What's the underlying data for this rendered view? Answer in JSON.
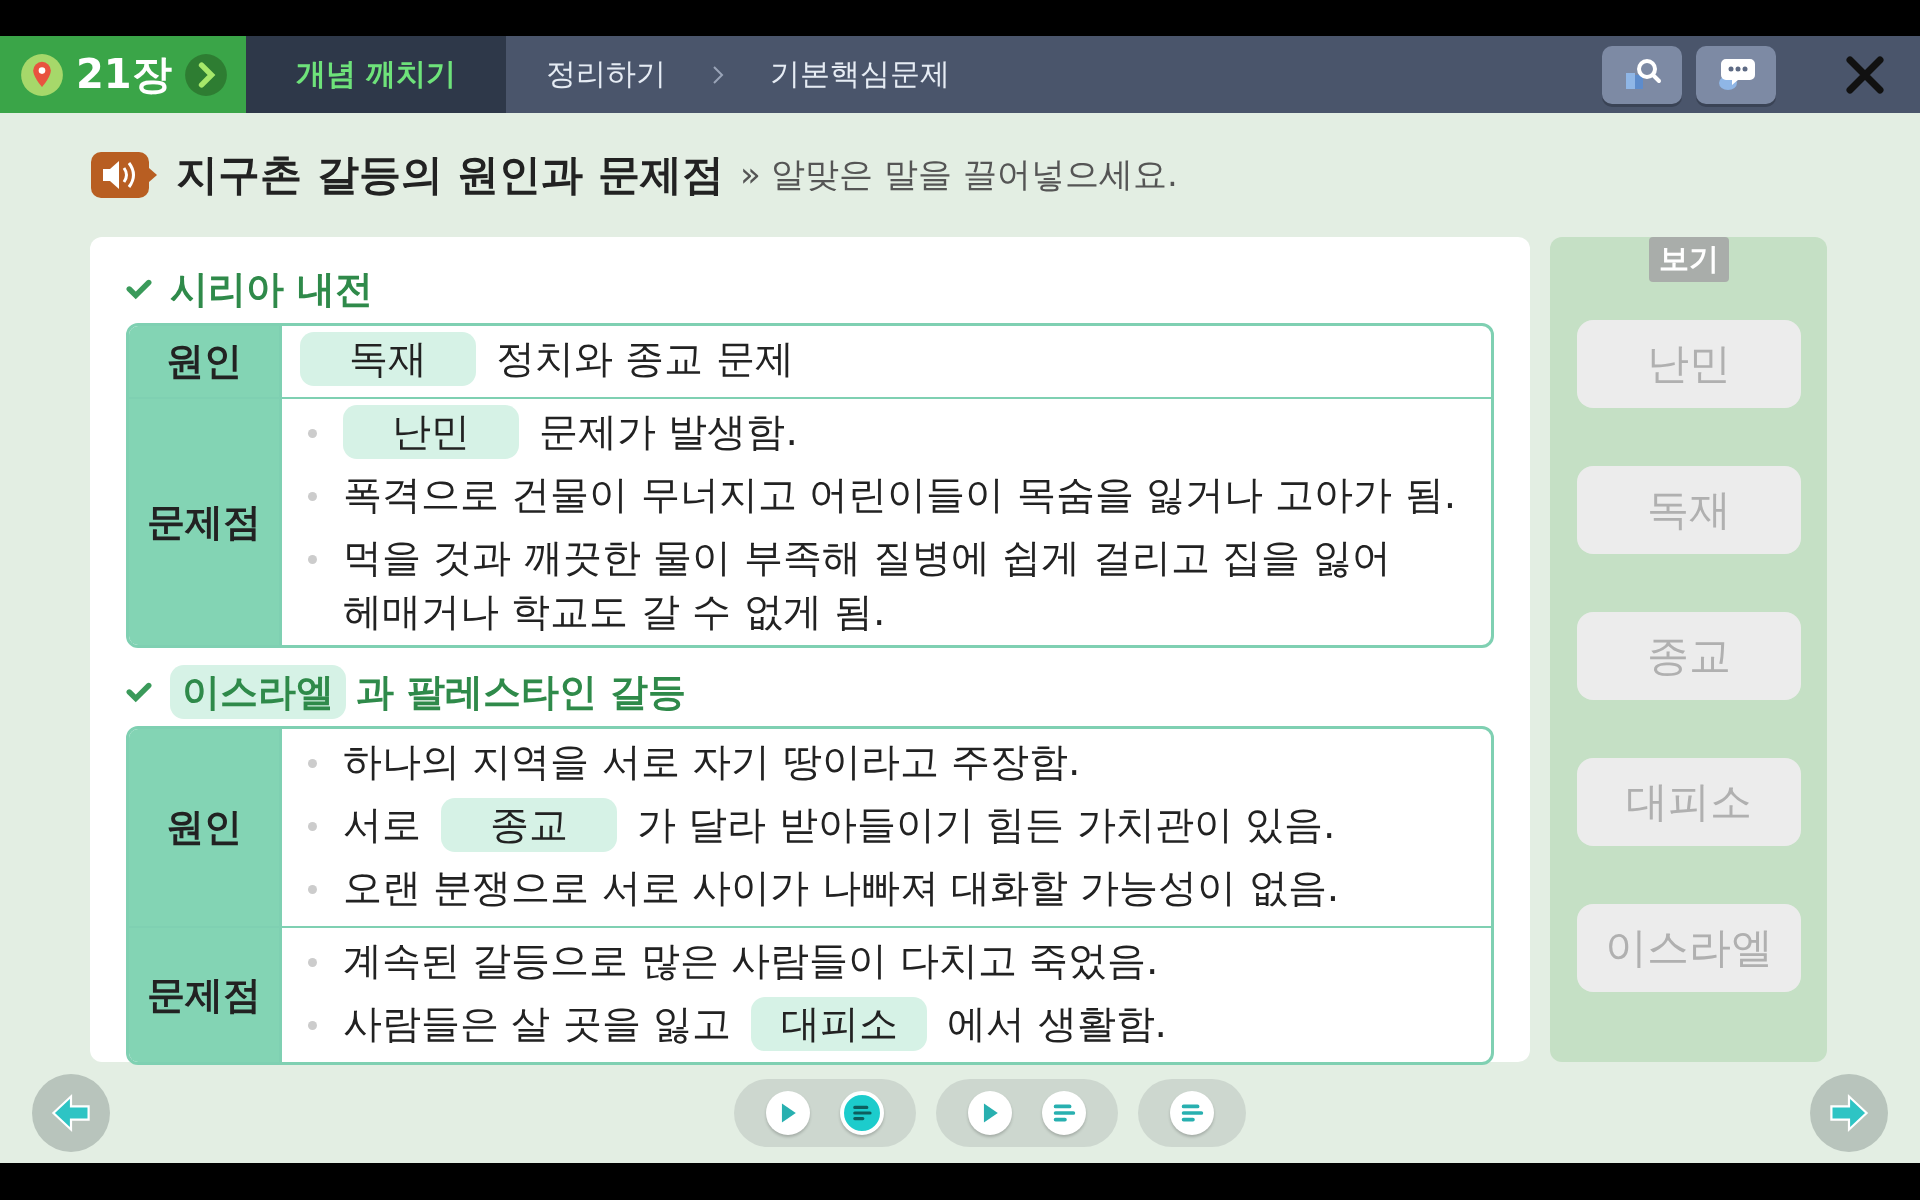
{
  "chapter": {
    "label": "21장"
  },
  "tabs": [
    {
      "label": "개념 깨치기",
      "selected": true
    },
    {
      "label": "정리하기",
      "selected": false
    },
    {
      "label": "기본핵심문제",
      "selected": false
    }
  ],
  "heading": {
    "title": "지구촌 갈등의 원인과 문제점",
    "instruction": "» 알맞은 말을 끌어넣으세요."
  },
  "sections": [
    {
      "title_parts": [
        {
          "kind": "text",
          "text": "시리아 내전"
        }
      ],
      "rows": [
        {
          "label": "원인",
          "lines": [
            {
              "bullet": false,
              "parts": [
                {
                  "kind": "blank",
                  "text": "독재"
                },
                {
                  "kind": "text",
                  "text": "정치와 종교 문제"
                }
              ]
            }
          ]
        },
        {
          "label": "문제점",
          "lines": [
            {
              "bullet": true,
              "parts": [
                {
                  "kind": "blank",
                  "text": "난민"
                },
                {
                  "kind": "text",
                  "text": "문제가 발생함."
                }
              ]
            },
            {
              "bullet": true,
              "parts": [
                {
                  "kind": "text",
                  "text": "폭격으로 건물이 무너지고 어린이들이 목숨을 잃거나 고아가 됨."
                }
              ]
            },
            {
              "bullet": true,
              "parts": [
                {
                  "kind": "text",
                  "text": "먹을 것과 깨끗한 물이 부족해 질병에 쉽게 걸리고 집을 잃어 헤매거나 학교도 갈 수 없게 됨."
                }
              ]
            }
          ]
        }
      ]
    },
    {
      "title_parts": [
        {
          "kind": "blank",
          "text": "이스라엘"
        },
        {
          "kind": "text",
          "text": "과 팔레스타인 갈등"
        }
      ],
      "rows": [
        {
          "label": "원인",
          "lines": [
            {
              "bullet": true,
              "parts": [
                {
                  "kind": "text",
                  "text": "하나의 지역을 서로 자기 땅이라고 주장함."
                }
              ]
            },
            {
              "bullet": true,
              "parts": [
                {
                  "kind": "text",
                  "text": "서로"
                },
                {
                  "kind": "blank",
                  "text": "종교"
                },
                {
                  "kind": "text",
                  "text": "가 달라 받아들이기 힘든 가치관이 있음."
                }
              ]
            },
            {
              "bullet": true,
              "parts": [
                {
                  "kind": "text",
                  "text": "오랜 분쟁으로 서로 사이가 나빠져 대화할 가능성이 없음."
                }
              ]
            }
          ]
        },
        {
          "label": "문제점",
          "lines": [
            {
              "bullet": true,
              "parts": [
                {
                  "kind": "text",
                  "text": "계속된 갈등으로 많은 사람들이 다치고 죽었음."
                }
              ]
            },
            {
              "bullet": true,
              "parts": [
                {
                  "kind": "text",
                  "text": "사람들은 살 곳을 잃고"
                },
                {
                  "kind": "blank",
                  "text": "대피소"
                },
                {
                  "kind": "text",
                  "text": "에서 생활함."
                }
              ]
            }
          ]
        }
      ]
    }
  ],
  "word_bank": {
    "title": "보기",
    "words": [
      {
        "text": "난민",
        "used": true
      },
      {
        "text": "독재",
        "used": true
      },
      {
        "text": "종교",
        "used": true
      },
      {
        "text": "대피소",
        "used": true
      },
      {
        "text": "이스라엘",
        "used": true
      }
    ]
  },
  "players": [
    {
      "buttons": [
        {
          "kind": "play",
          "selected": false
        },
        {
          "kind": "script",
          "selected": true
        }
      ]
    },
    {
      "buttons": [
        {
          "kind": "play",
          "selected": false
        },
        {
          "kind": "script",
          "selected": false
        }
      ]
    },
    {
      "buttons": [
        {
          "kind": "script",
          "selected": false
        }
      ]
    }
  ]
}
